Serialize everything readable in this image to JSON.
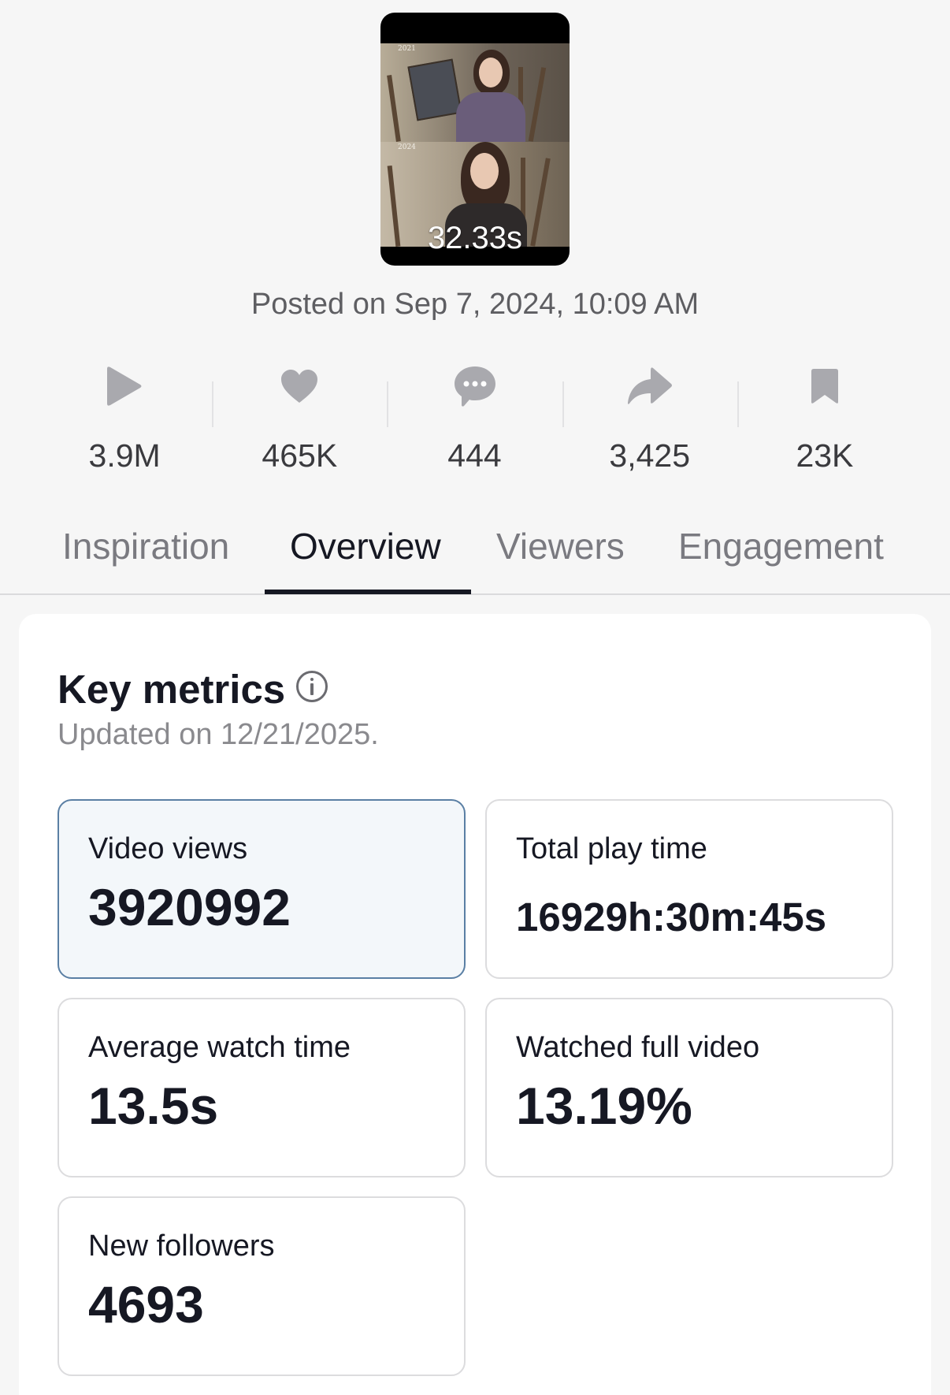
{
  "video": {
    "frame_top_year": "2021",
    "frame_bottom_year": "2024",
    "duration": "32.33s"
  },
  "posted": "Posted on Sep 7, 2024, 10:09 AM",
  "stats": [
    {
      "icon": "play-icon",
      "value": "3.9M"
    },
    {
      "icon": "heart-icon",
      "value": "465K"
    },
    {
      "icon": "comment-icon",
      "value": "444"
    },
    {
      "icon": "share-icon",
      "value": "3,425"
    },
    {
      "icon": "bookmark-icon",
      "value": "23K"
    }
  ],
  "tabs": [
    {
      "label": "Inspiration",
      "active": false
    },
    {
      "label": "Overview",
      "active": true
    },
    {
      "label": "Viewers",
      "active": false
    },
    {
      "label": "Engagement",
      "active": false
    }
  ],
  "key_metrics": {
    "title": "Key metrics",
    "updated": "Updated on 12/21/2025.",
    "items": [
      {
        "label": "Video views",
        "value": "3920992",
        "selected": true
      },
      {
        "label": "Total play time",
        "value": "16929h:30m:45s",
        "selected": false
      },
      {
        "label": "Average watch time",
        "value": "13.5s",
        "selected": false
      },
      {
        "label": "Watched full video",
        "value": "13.19%",
        "selected": false
      },
      {
        "label": "New followers",
        "value": "4693",
        "selected": false
      }
    ]
  },
  "colors": {
    "background": "#f6f6f6",
    "text_primary": "#161823",
    "selected_card_bg": "#f3f7fa",
    "selected_card_border": "#5a7fa4",
    "icon_gray": "#a9a9ae"
  }
}
